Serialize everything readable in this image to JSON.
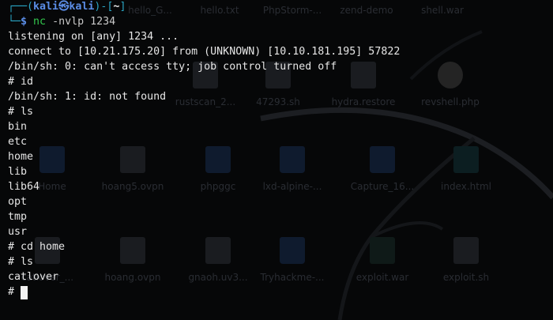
{
  "desktop": {
    "icons_top": [
      {
        "label": "hello_G...",
        "kind": "file"
      },
      {
        "label": "hello.txt",
        "kind": "file"
      },
      {
        "label": "PhpStorm-...",
        "kind": "file"
      },
      {
        "label": "zend-demo",
        "kind": "folder"
      },
      {
        "label": "shell.war",
        "kind": "zip"
      }
    ],
    "icons_row2": [
      {
        "label": "rustscan_2...",
        "kind": "file"
      },
      {
        "label": "47293.sh",
        "kind": "file"
      },
      {
        "label": "hydra.restore",
        "kind": "file"
      },
      {
        "label": "revshell.php",
        "kind": "file"
      }
    ],
    "icons_row3": [
      {
        "label": "Home",
        "kind": "folder"
      },
      {
        "label": "hoang5.ovpn",
        "kind": "file"
      },
      {
        "label": "phpggc",
        "kind": "folder"
      },
      {
        "label": "lxd-alpine-...",
        "kind": "folder"
      },
      {
        "label": "Capture_16...",
        "kind": "folder"
      },
      {
        "label": "index.html",
        "kind": "web"
      }
    ],
    "icons_row4": [
      {
        "label": "catlover_...",
        "kind": "file"
      },
      {
        "label": "hoang.ovpn",
        "kind": "file"
      },
      {
        "label": "gnaoh.uv3...",
        "kind": "file"
      },
      {
        "label": "Tryhackme-...",
        "kind": "folder"
      },
      {
        "label": "exploit.war",
        "kind": "zip"
      },
      {
        "label": "exploit.sh",
        "kind": "file"
      }
    ]
  },
  "terminal": {
    "prompt": {
      "box_top": "┌──(",
      "user": "kali",
      "at": "㉿",
      "host": "kali",
      "dir_open": ")-[",
      "dir": "~",
      "dir_close": "]",
      "box_bottom": "└─",
      "dollar": "$",
      "command": "nc",
      "args": "-nvlp 1234"
    },
    "lines": [
      "listening on [any] 1234 ...",
      "connect to [10.21.175.20] from (UNKNOWN) [10.10.181.195] 57822",
      "/bin/sh: 0: can't access tty; job control turned off",
      "# id",
      "/bin/sh: 1: id: not found",
      "# ls",
      "bin",
      "etc",
      "home",
      "lib",
      "lib64",
      "opt",
      "tmp",
      "usr",
      "# cd home",
      "# ls",
      "catlover"
    ],
    "current_prompt": "# "
  }
}
